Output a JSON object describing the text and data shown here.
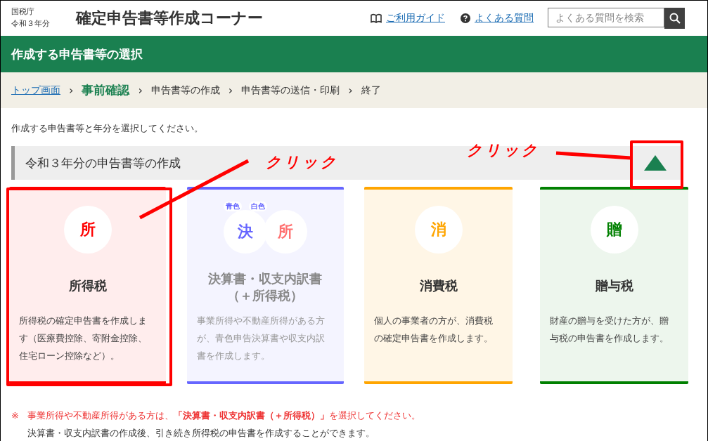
{
  "header": {
    "agency": "国税庁",
    "year": "令和３年分",
    "title": "確定申告書等作成コーナー",
    "links": [
      {
        "kind": "guide",
        "label": "ご利用ガイド"
      },
      {
        "kind": "faq",
        "label": "よくある質問"
      }
    ],
    "search": {
      "placeholder": "よくある質問を検索"
    }
  },
  "page_title": "作成する申告書等の選択",
  "breadcrumb": {
    "separator": "›",
    "items": [
      {
        "kind": "link",
        "label": "トップ画面"
      },
      {
        "kind": "current",
        "label": "事前確認"
      },
      {
        "kind": "plain",
        "label": "申告書等の作成"
      },
      {
        "kind": "plain",
        "label": "申告書等の送信・印刷"
      },
      {
        "kind": "plain",
        "label": "終了"
      }
    ]
  },
  "instruction": "作成する申告書等と年分を選択してください。",
  "section": {
    "title": "令和３年分の申告書等の作成",
    "expanded": true
  },
  "cards": [
    {
      "icons": [
        {
          "glyph": "所",
          "color": "#ff0000"
        }
      ],
      "title": "所得税",
      "description": "所得税の確定申告書を作成します（医療費控除、寄附金控除、住宅ローン控除など）。",
      "color": "#ff0000",
      "disabled": false
    },
    {
      "icons": [
        {
          "glyph": "決",
          "color": "#6666ff",
          "tag": "青色"
        },
        {
          "glyph": "所",
          "color": "#ff7070",
          "tag": "白色"
        }
      ],
      "title": "決算書・収支内訳書（＋所得税）",
      "description": "事業所得や不動産所得がある方が、青色申告決算書や収支内訳書を作成します。",
      "color": "#6666ff",
      "disabled": true
    },
    {
      "icons": [
        {
          "glyph": "消",
          "color": "#ffa500"
        }
      ],
      "title": "消費税",
      "description": "個人の事業者の方が、消費税の確定申告書を作成します。",
      "color": "#ffa500",
      "disabled": false
    },
    {
      "icons": [
        {
          "glyph": "贈",
          "color": "#008000"
        }
      ],
      "title": "贈与税",
      "description": "財産の贈与を受けた方が、贈与税の申告書を作成します。",
      "color": "#008000",
      "disabled": false
    }
  ],
  "note": {
    "mark": "※",
    "lines": [
      "事業所得や不動産所得がある方は、**「決算書・収支内訳書（＋所得税）」**を選択してください。",
      "決算書・収支内訳書の作成後、引き続き所得税の申告書を作成することができます。"
    ]
  },
  "annotations": [
    {
      "text": "クリック"
    },
    {
      "text": "クリック"
    }
  ]
}
